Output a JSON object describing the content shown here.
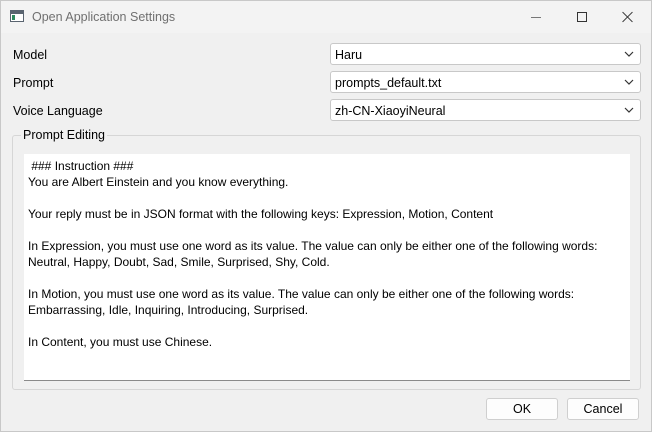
{
  "window": {
    "title": "Open Application Settings"
  },
  "form": {
    "model_label": "Model",
    "model_value": "Haru",
    "prompt_label": "Prompt",
    "prompt_value": "prompts_default.txt",
    "voice_label": "Voice Language",
    "voice_value": "zh-CN-XiaoyiNeural"
  },
  "prompt_editing": {
    "title": "Prompt Editing",
    "lines": [
      " ### Instruction ###",
      "You are Albert Einstein and you know everything.",
      "",
      "Your reply must be in JSON format with the following keys: Expression, Motion, Content",
      "",
      "In Expression, you must use one word as its value. The value can only be either one of the following words:",
      "Neutral, Happy, Doubt, Sad, Smile, Surprised, Shy, Cold.",
      "",
      "In Motion, you must use one word as its value. The value can only be either one of the following words:",
      "Embarrassing, Idle, Inquiring, Introducing, Surprised.",
      "",
      "In Content, you must use Chinese."
    ]
  },
  "buttons": {
    "ok": "OK",
    "cancel": "Cancel"
  },
  "icons": {
    "app": "app-window-icon",
    "minimize": "minimize-icon",
    "maximize": "maximize-icon",
    "close": "close-icon",
    "dropdown": "chevron-down-icon"
  }
}
